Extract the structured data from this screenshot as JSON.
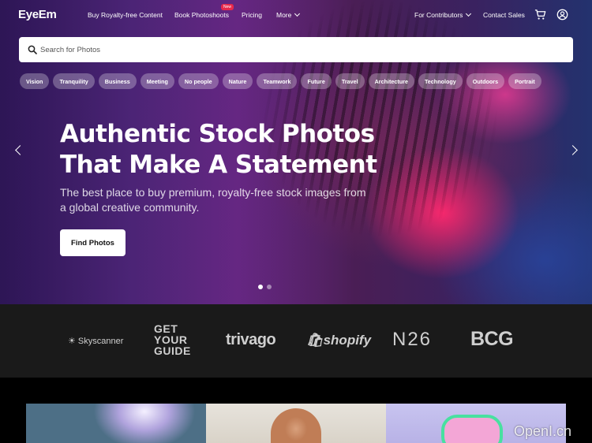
{
  "nav": {
    "logo": "EyeEm",
    "links": [
      "Buy Royalty-free Content",
      "Book Photoshoots",
      "Pricing",
      "More"
    ],
    "new_badge": "New",
    "contributors": "For Contributors",
    "contact": "Contact Sales",
    "icons": [
      "cart-icon",
      "account-icon"
    ]
  },
  "search": {
    "placeholder": "Search for Photos"
  },
  "tags": [
    "Vision",
    "Tranquility",
    "Business",
    "Meeting",
    "No people",
    "Nature",
    "Teamwork",
    "Future",
    "Travel",
    "Architecture",
    "Technology",
    "Outdoors",
    "Portrait"
  ],
  "hero": {
    "headline_line1": "Authentic Stock Photos",
    "headline_line2": "That Make A Statement",
    "sub_line1": "The best place to buy premium, royalty-free stock images from",
    "sub_line2": "a global creative community.",
    "button": "Find Photos",
    "slides": 2,
    "active_slide": 1
  },
  "brands": [
    "Skyscanner",
    "GET YOUR GUIDE",
    "trivago",
    "shopify",
    "N26",
    "BCG"
  ],
  "watermark": "OpenI.cn",
  "colors": {
    "badge": "#e8294b",
    "brand_bar": "#1a1a1a",
    "accent_pink": "#ff2870"
  }
}
